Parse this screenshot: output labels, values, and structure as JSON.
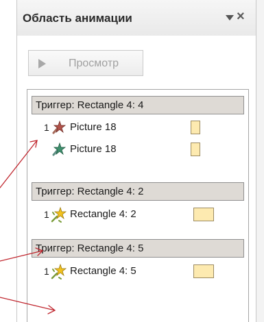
{
  "pane": {
    "title": "Область анимации",
    "close_glyph": "×",
    "preview_label": "Просмотр"
  },
  "groups": [
    {
      "trigger": "Триггер: Rectangle 4: 4",
      "rows": [
        {
          "num": "1",
          "label": "Picture 18",
          "icon": "star-effect-red-icon"
        },
        {
          "num": "",
          "label": "Picture 18",
          "icon": "star-effect-green-icon"
        }
      ]
    },
    {
      "trigger": "Триггер: Rectangle 4: 2",
      "rows": [
        {
          "num": "1",
          "label": "Rectangle 4: 2",
          "icon": "star-effect-yellow-icon"
        }
      ]
    },
    {
      "trigger": "Триггер: Rectangle 4: 5",
      "rows": [
        {
          "num": "1",
          "label": "Rectangle 4: 5",
          "icon": "star-effect-yellow-icon"
        }
      ]
    }
  ],
  "colors": {
    "trigger_bg": "#dedad5",
    "timing_fill": "#fdeab0",
    "arrow": "#c0262e"
  }
}
